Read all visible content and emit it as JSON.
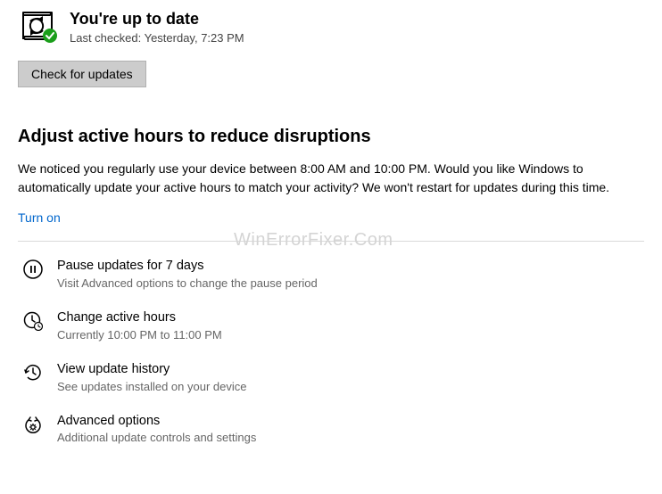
{
  "status": {
    "title": "You're up to date",
    "last_checked": "Last checked: Yesterday, 7:23 PM"
  },
  "buttons": {
    "check_updates": "Check for updates"
  },
  "active_hours": {
    "title": "Adjust active hours to reduce disruptions",
    "body": "We noticed you regularly use your device between 8:00 AM and 10:00 PM. Would you like Windows to automatically update your active hours to match your activity? We won't restart for updates during this time.",
    "turn_on": "Turn on"
  },
  "options": {
    "pause": {
      "title": "Pause updates for 7 days",
      "sub": "Visit Advanced options to change the pause period"
    },
    "change_hours": {
      "title": "Change active hours",
      "sub": "Currently 10:00 PM to 11:00 PM"
    },
    "history": {
      "title": "View update history",
      "sub": "See updates installed on your device"
    },
    "advanced": {
      "title": "Advanced options",
      "sub": "Additional update controls and settings"
    }
  },
  "watermark": "WinErrorFixer.Com"
}
